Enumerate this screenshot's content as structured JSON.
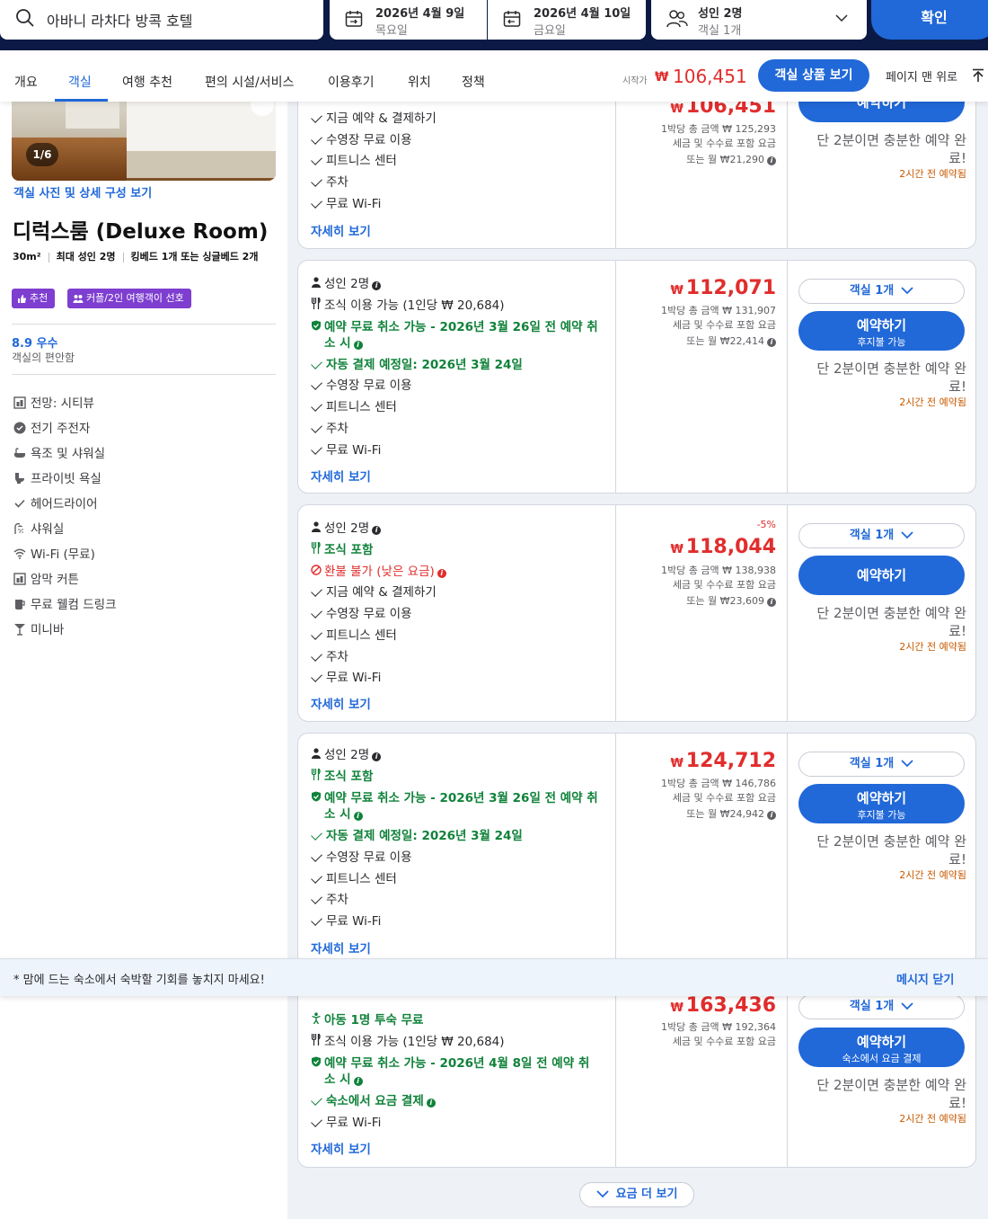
{
  "search": {
    "destination": "아바니 라차다 방콕 호텔",
    "checkin_date": "2026년 4월 9일",
    "checkin_day": "목요일",
    "checkout_date": "2026년 4월 10일",
    "checkout_day": "금요일",
    "guests": "성인 2명",
    "rooms": "객실 1개",
    "confirm": "확인"
  },
  "tabs": [
    "개요",
    "객실",
    "여행 추천",
    "편의 시설/서비스",
    "이용후기",
    "위치",
    "정책"
  ],
  "active_tab": "객실",
  "tabbar": {
    "price_label": "시작가",
    "currency": "₩",
    "price": "106,451",
    "view_button": "객실 상품 보기",
    "top_link": "페이지 맨 위로"
  },
  "room": {
    "photo_counter": "1/6",
    "photo_link": "객실 사진 및 상세 구성 보기",
    "title": "디럭스룸 (Deluxe Room)",
    "size": "30m²",
    "max_guests": "최대 성인 2명",
    "beds": "킹베드 1개 또는 싱글베드 2개",
    "tag_recommend": "추천",
    "tag_couple": "커플/2인 여행객이 선호",
    "score": "8.9 우수",
    "score_sub": "객실의 편안함",
    "amenities": [
      "전망: 시티뷰",
      "전기 주전자",
      "욕조 및 샤워실",
      "프라이빗 욕실",
      "헤어드라이어",
      "샤워실",
      "Wi-Fi (무료)",
      "암막 커튼",
      "무료 웰컴 드링크",
      "미니바"
    ]
  },
  "offers": [
    {
      "rows": [
        "지금 예약 & 결제하기",
        "수영장 무료 이용",
        "피트니스 센터",
        "주차",
        "무료 Wi-Fi"
      ],
      "more": "자세히 보기",
      "currency": "₩",
      "price": "106,451",
      "total": "1박당 총 금액 ₩ 125,293",
      "tax": "세금 및 수수료 포함 요금",
      "monthly": "또는 월 ₩21,290",
      "book": "예약하기",
      "hurry": "단 2분이면 충분한 예약 완료!",
      "booked": "2시간 전 예약됨"
    },
    {
      "guests": "성인 2명",
      "breakfast": "조식 이용 가능 (1인당 ₩ 20,684)",
      "cancel_line1": "예약 무료 취소 가능 - 2026년 3월 26일 전 예약 취",
      "cancel_line2": "소 시",
      "autopay": "자동 결제 예정일: 2026년 3월 24일",
      "rows": [
        "수영장 무료 이용",
        "피트니스 센터",
        "주차",
        "무료 Wi-Fi"
      ],
      "more": "자세히 보기",
      "currency": "₩",
      "price": "112,071",
      "total": "1박당 총 금액 ₩ 131,907",
      "tax": "세금 및 수수료 포함 요금",
      "monthly": "또는 월 ₩22,414",
      "rooms_select": "객실 1개",
      "book": "예약하기",
      "book_sub": "후지불 가능",
      "hurry": "단 2분이면 충분한 예약 완료!",
      "booked": "2시간 전 예약됨"
    },
    {
      "guests": "성인 2명",
      "breakfast": "조식 포함",
      "refund": "환불 불가 (낮은 요금)",
      "rows": [
        "지금 예약 & 결제하기",
        "수영장 무료 이용",
        "피트니스 센터",
        "주차",
        "무료 Wi-Fi"
      ],
      "more": "자세히 보기",
      "discount": "-5%",
      "currency": "₩",
      "price": "118,044",
      "total": "1박당 총 금액 ₩ 138,938",
      "tax": "세금 및 수수료 포함 요금",
      "monthly": "또는 월 ₩23,609",
      "rooms_select": "객실 1개",
      "book": "예약하기",
      "hurry": "단 2분이면 충분한 예약 완료!",
      "booked": "2시간 전 예약됨"
    },
    {
      "guests": "성인 2명",
      "breakfast": "조식 포함",
      "cancel_line1": "예약 무료 취소 가능 - 2026년 3월 26일 전 예약 취",
      "cancel_line2": "소 시",
      "autopay": "자동 결제 예정일: 2026년 3월 24일",
      "rows": [
        "수영장 무료 이용",
        "피트니스 센터",
        "주차",
        "무료 Wi-Fi"
      ],
      "more": "자세히 보기",
      "currency": "₩",
      "price": "124,712",
      "total": "1박당 총 금액 ₩ 146,786",
      "tax": "세금 및 수수료 포함 요금",
      "monthly": "또는 월 ₩24,942",
      "rooms_select": "객실 1개",
      "book": "예약하기",
      "book_sub": "후지불 가능",
      "hurry": "단 2분이면 충분한 예약 완료!",
      "booked": "2시간 전 예약됨"
    },
    {
      "child": "아동 1명 투숙 무료",
      "breakfast": "조식 이용 가능 (1인당 ₩ 20,684)",
      "cancel_line1": "예약 무료 취소 가능 - 2026년 4월 8일 전 예약 취",
      "cancel_line2": "소 시",
      "pay_at_hotel": "숙소에서 요금 결제",
      "rows": [
        "무료 Wi-Fi"
      ],
      "more": "자세히 보기",
      "currency": "₩",
      "price": "163,436",
      "total": "1박당 총 금액 ₩ 192,364",
      "tax": "세금 및 수수료 포함 요금",
      "rooms_select": "객실 1개",
      "book": "예약하기",
      "book_sub": "숙소에서 요금 결제",
      "hurry": "단 2분이면 충분한 예약 완료!",
      "booked": "2시간 전 예약됨"
    }
  ],
  "banner": {
    "message": "* 맘에 드는 숙소에서 숙박할 기회를 놓치지 마세요!",
    "close": "메시지 닫기"
  },
  "more_rates": "요금 더 보기",
  "colors": {
    "brand": "#2168d8",
    "navy": "#0b1a45",
    "price": "#e12d2d",
    "green": "#10823a",
    "tag": "#7e3ed0"
  }
}
